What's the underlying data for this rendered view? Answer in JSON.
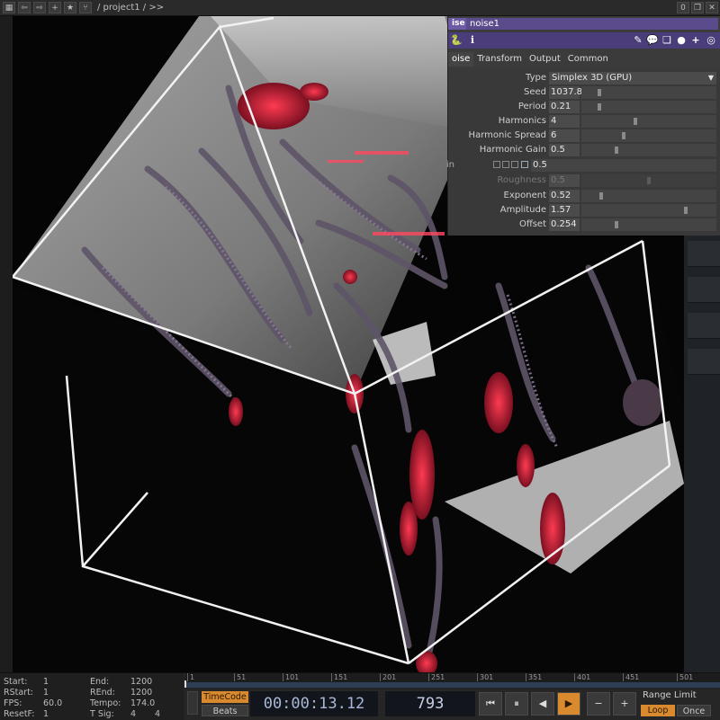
{
  "topbar": {
    "path": "/ project1 / >>",
    "counter": "0",
    "left_icons": [
      "grid-icon",
      "back-arrow-icon",
      "forward-arrow-icon",
      "plus-icon",
      "star-icon",
      "branch-icon"
    ],
    "right_icons": [
      "restore-window-icon",
      "close-window-icon"
    ]
  },
  "panel": {
    "op_type": "ise",
    "op_name": "noise1",
    "icons": [
      "python-icon",
      "info-icon",
      "pencil-icon",
      "comment-icon",
      "clone-icon",
      "python-logo-icon",
      "plus-icon",
      "target-icon"
    ],
    "tabs": [
      "oise",
      "Transform",
      "Output",
      "Common"
    ],
    "params": [
      {
        "label": "Type",
        "kind": "select",
        "value": "Simplex 3D (GPU)"
      },
      {
        "label": "Seed",
        "kind": "slider",
        "value": "1037.8",
        "level": 0.12
      },
      {
        "label": "Period",
        "kind": "slider",
        "value": "0.21",
        "level": 0.12
      },
      {
        "label": "Harmonics",
        "kind": "slider",
        "value": "4",
        "level": 0.4
      },
      {
        "label": "Harmonic Spread",
        "kind": "slider",
        "value": "6",
        "level": 0.31
      },
      {
        "label": "Harmonic Gain",
        "kind": "slider",
        "value": "0.5",
        "level": 0.25
      },
      {
        "label": "in",
        "kind": "checkbox",
        "value": "0.5"
      },
      {
        "label": "Roughness",
        "kind": "slider",
        "value": "0.5",
        "level": 0.5,
        "disabled": true
      },
      {
        "label": "Exponent",
        "kind": "slider",
        "value": "0.52",
        "level": 0.14
      },
      {
        "label": "Amplitude",
        "kind": "slider",
        "value": "1.57",
        "level": 0.78
      },
      {
        "label": "Offset",
        "kind": "slider",
        "value": "0.254",
        "level": 0.25
      }
    ]
  },
  "stats": {
    "start_label": "Start:",
    "start": "1",
    "rstart_label": "RStart:",
    "rstart": "1",
    "fps_label": "FPS:",
    "fps": "60.0",
    "resetf_label": "ResetF:",
    "resetf": "1",
    "end_label": "End:",
    "end": "1200",
    "rend_label": "REnd:",
    "rend": "1200",
    "tempo_label": "Tempo:",
    "tempo": "174.0",
    "tsig_label": "T Sig:",
    "tsig_a": "4",
    "tsig_b": "4"
  },
  "timeline": {
    "ticks": [
      "1",
      "51",
      "101",
      "151",
      "201",
      "251",
      "301",
      "351",
      "401",
      "451",
      "501"
    ],
    "timecode_label": "TimeCode",
    "beats_label": "Beats",
    "timecode": "00:00:13.12",
    "frame": "793",
    "range_limit_label": "Range Limit",
    "loop_label": "Loop",
    "once_label": "Once",
    "transport": [
      "skip-to-start-icon",
      "pause-icon",
      "step-back-icon",
      "play-icon",
      "minus-icon",
      "plus-icon"
    ]
  },
  "colors": {
    "accent": "#d98a2e",
    "op_purple": "#5b4b8c",
    "timecode_bg": "#12151b"
  }
}
